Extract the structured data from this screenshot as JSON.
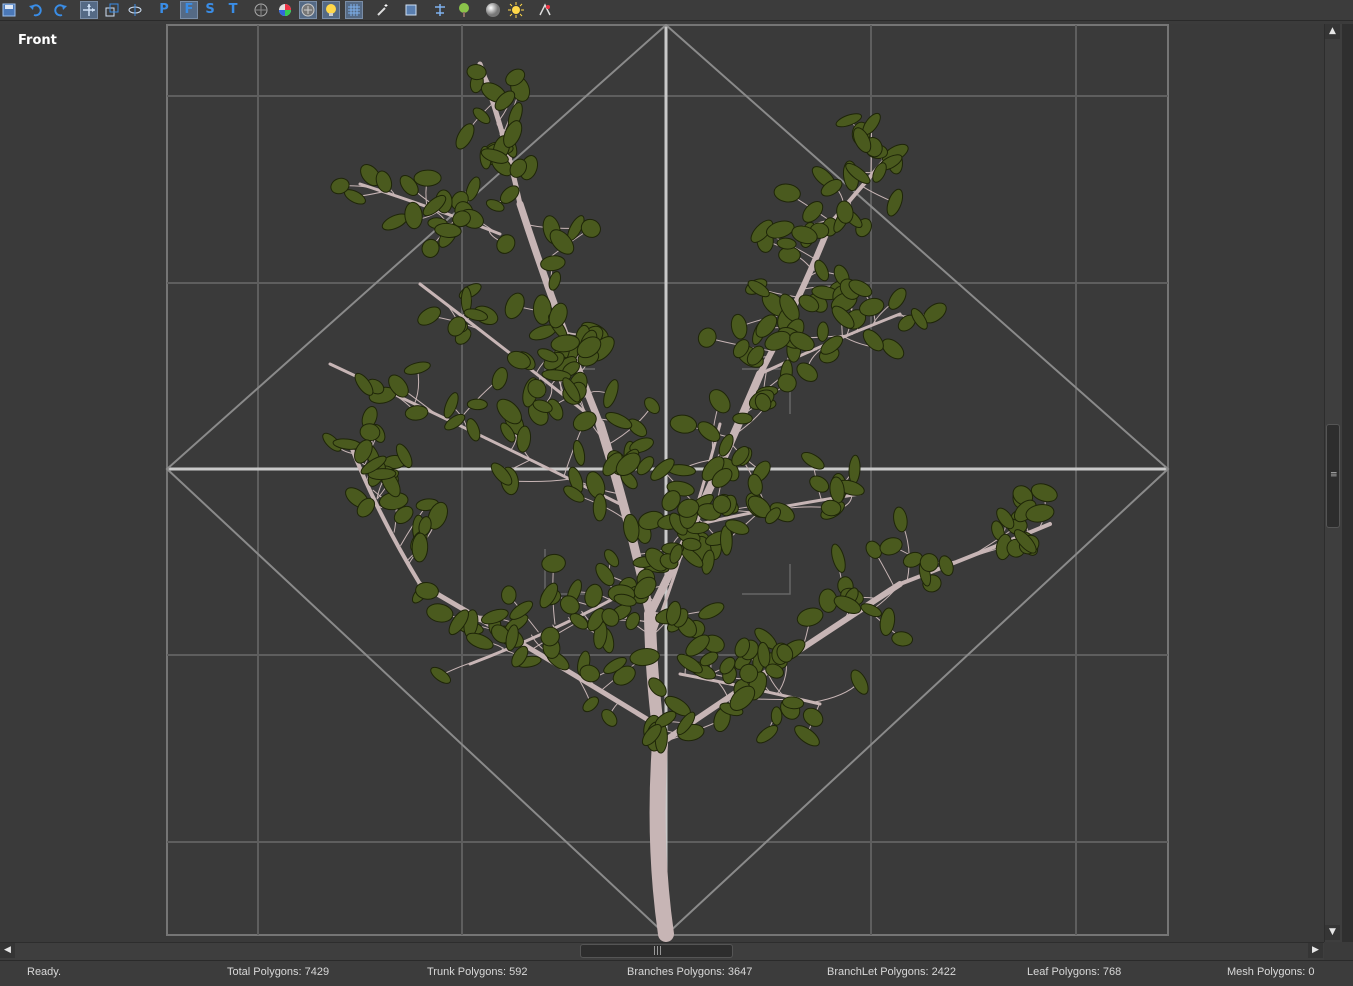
{
  "toolbar": {
    "items": [
      {
        "name": "save-icon"
      },
      {
        "name": "undo-icon"
      },
      {
        "name": "redo-icon"
      },
      {
        "name": "move-tool-icon"
      },
      {
        "name": "scale-tool-icon"
      },
      {
        "name": "rotate-tool-icon"
      },
      {
        "name": "view-perspective-button",
        "label": "P"
      },
      {
        "name": "view-front-button",
        "label": "F"
      },
      {
        "name": "view-side-button",
        "label": "S"
      },
      {
        "name": "view-top-button",
        "label": "T"
      },
      {
        "name": "wireframe-icon"
      },
      {
        "name": "color-wheel-icon"
      },
      {
        "name": "texture-sphere-icon"
      },
      {
        "name": "light-bulb-icon"
      },
      {
        "name": "grid-icon"
      },
      {
        "name": "magic-wand-icon"
      },
      {
        "name": "frame-view-icon"
      },
      {
        "name": "align-icon"
      },
      {
        "name": "tree-icon"
      },
      {
        "name": "shaded-sphere-icon"
      },
      {
        "name": "sun-icon"
      },
      {
        "name": "render-icon"
      }
    ],
    "accent": "#3a8de6"
  },
  "viewport": {
    "label": "Front",
    "background": "#3a3a3a",
    "leaf_color": "#4a5a1e",
    "trunk_color": "#c7b5b5"
  },
  "status": {
    "ready": "Ready.",
    "total": "Total Polygons: 7429",
    "trunk": "Trunk Polygons: 592",
    "branches": "Branches Polygons: 3647",
    "branchlet": "BranchLet Polygons: 2422",
    "leaf": "Leaf Polygons:  768",
    "mesh": "Mesh Polygons:  0"
  }
}
